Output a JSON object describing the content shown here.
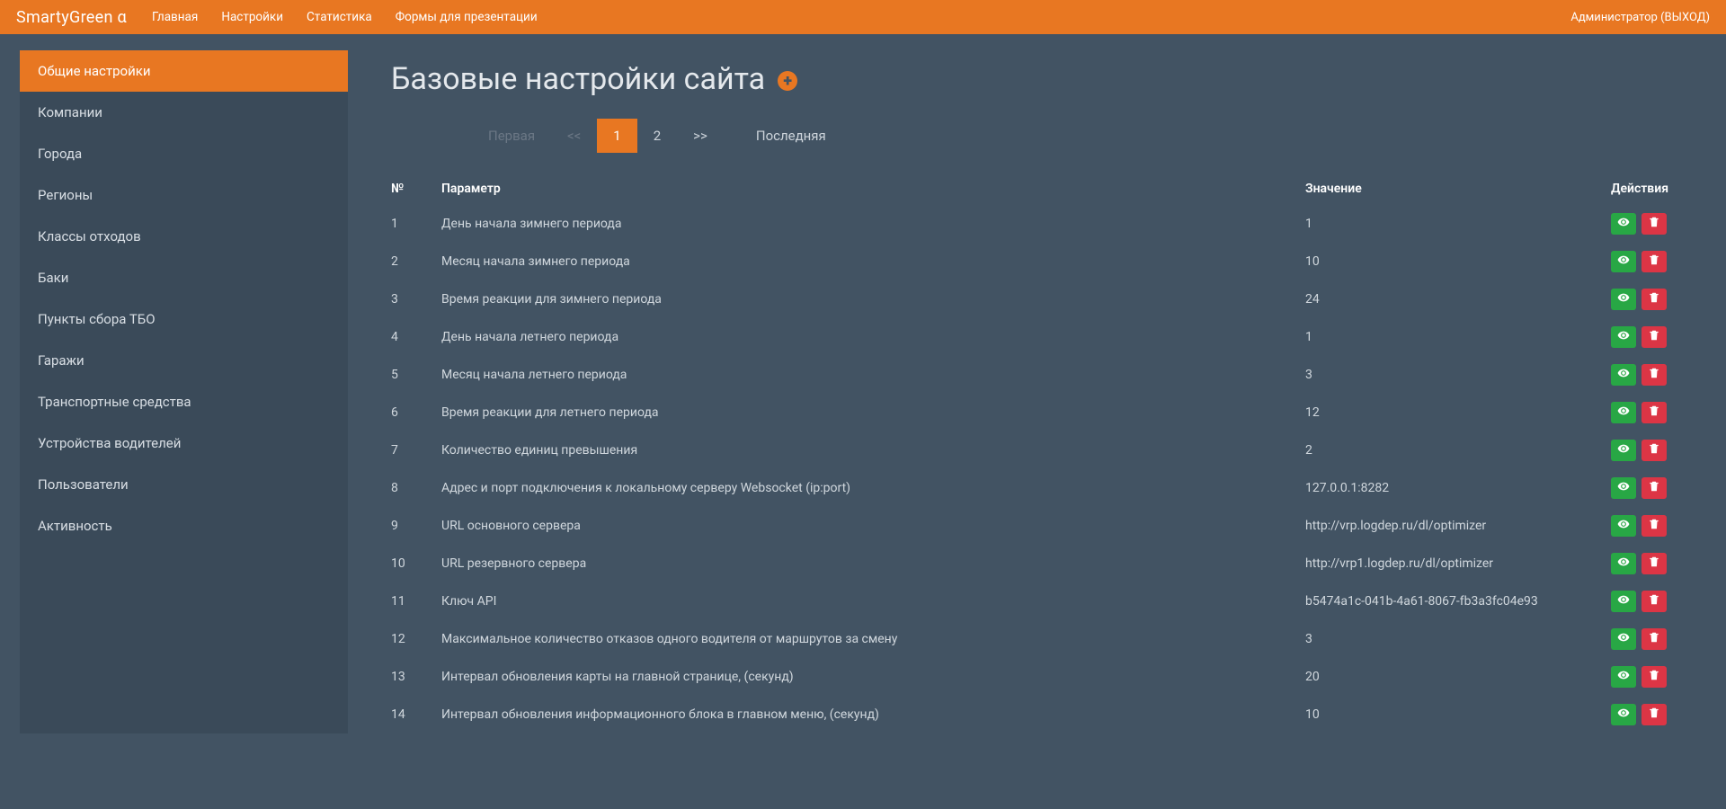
{
  "brand": "SmartyGreen α",
  "topnav": [
    "Главная",
    "Настройки",
    "Статистика",
    "Формы для презентации"
  ],
  "top_right": "Администратор (ВЫХОД)",
  "sidebar": {
    "items": [
      {
        "label": "Общие настройки",
        "active": true
      },
      {
        "label": "Компании"
      },
      {
        "label": "Города"
      },
      {
        "label": "Регионы"
      },
      {
        "label": "Классы отходов"
      },
      {
        "label": "Баки"
      },
      {
        "label": "Пункты сбора ТБО"
      },
      {
        "label": "Гаражи"
      },
      {
        "label": "Транспортные средства"
      },
      {
        "label": "Устройства водителей"
      },
      {
        "label": "Пользователи"
      },
      {
        "label": "Активность"
      }
    ]
  },
  "page_title": "Базовые настройки сайта",
  "pagination": {
    "first": "Первая",
    "prev": "<<",
    "pages": [
      "1",
      "2"
    ],
    "active_page": "1",
    "next": ">>",
    "last": "Последняя"
  },
  "table": {
    "headers": {
      "num": "№",
      "param": "Параметр",
      "value": "Значение",
      "actions": "Действия"
    },
    "rows": [
      {
        "num": "1",
        "param": "День начала зимнего периода",
        "value": "1"
      },
      {
        "num": "2",
        "param": "Месяц начала зимнего периода",
        "value": "10"
      },
      {
        "num": "3",
        "param": "Время реакции для зимнего периода",
        "value": "24"
      },
      {
        "num": "4",
        "param": "День начала летнего периода",
        "value": "1"
      },
      {
        "num": "5",
        "param": "Месяц начала летнего периода",
        "value": "3"
      },
      {
        "num": "6",
        "param": "Время реакции для летнего периода",
        "value": "12"
      },
      {
        "num": "7",
        "param": "Количество единиц превышения",
        "value": "2"
      },
      {
        "num": "8",
        "param": "Адрес и порт подключения к локальному серверу Websocket (ip:port)",
        "value": "127.0.0.1:8282"
      },
      {
        "num": "9",
        "param": "URL основного сервера",
        "value": "http://vrp.logdep.ru/dl/optimizer"
      },
      {
        "num": "10",
        "param": "URL резервного сервера",
        "value": "http://vrp1.logdep.ru/dl/optimizer"
      },
      {
        "num": "11",
        "param": "Ключ API",
        "value": "b5474a1c-041b-4a61-8067-fb3a3fc04e93"
      },
      {
        "num": "12",
        "param": "Максимальное количество отказов одного водителя от маршрутов за смену",
        "value": "3"
      },
      {
        "num": "13",
        "param": "Интервал обновления карты на главной странице, (секунд)",
        "value": "20"
      },
      {
        "num": "14",
        "param": "Интервал обновления информационного блока в главном меню, (секунд)",
        "value": "10"
      }
    ]
  }
}
